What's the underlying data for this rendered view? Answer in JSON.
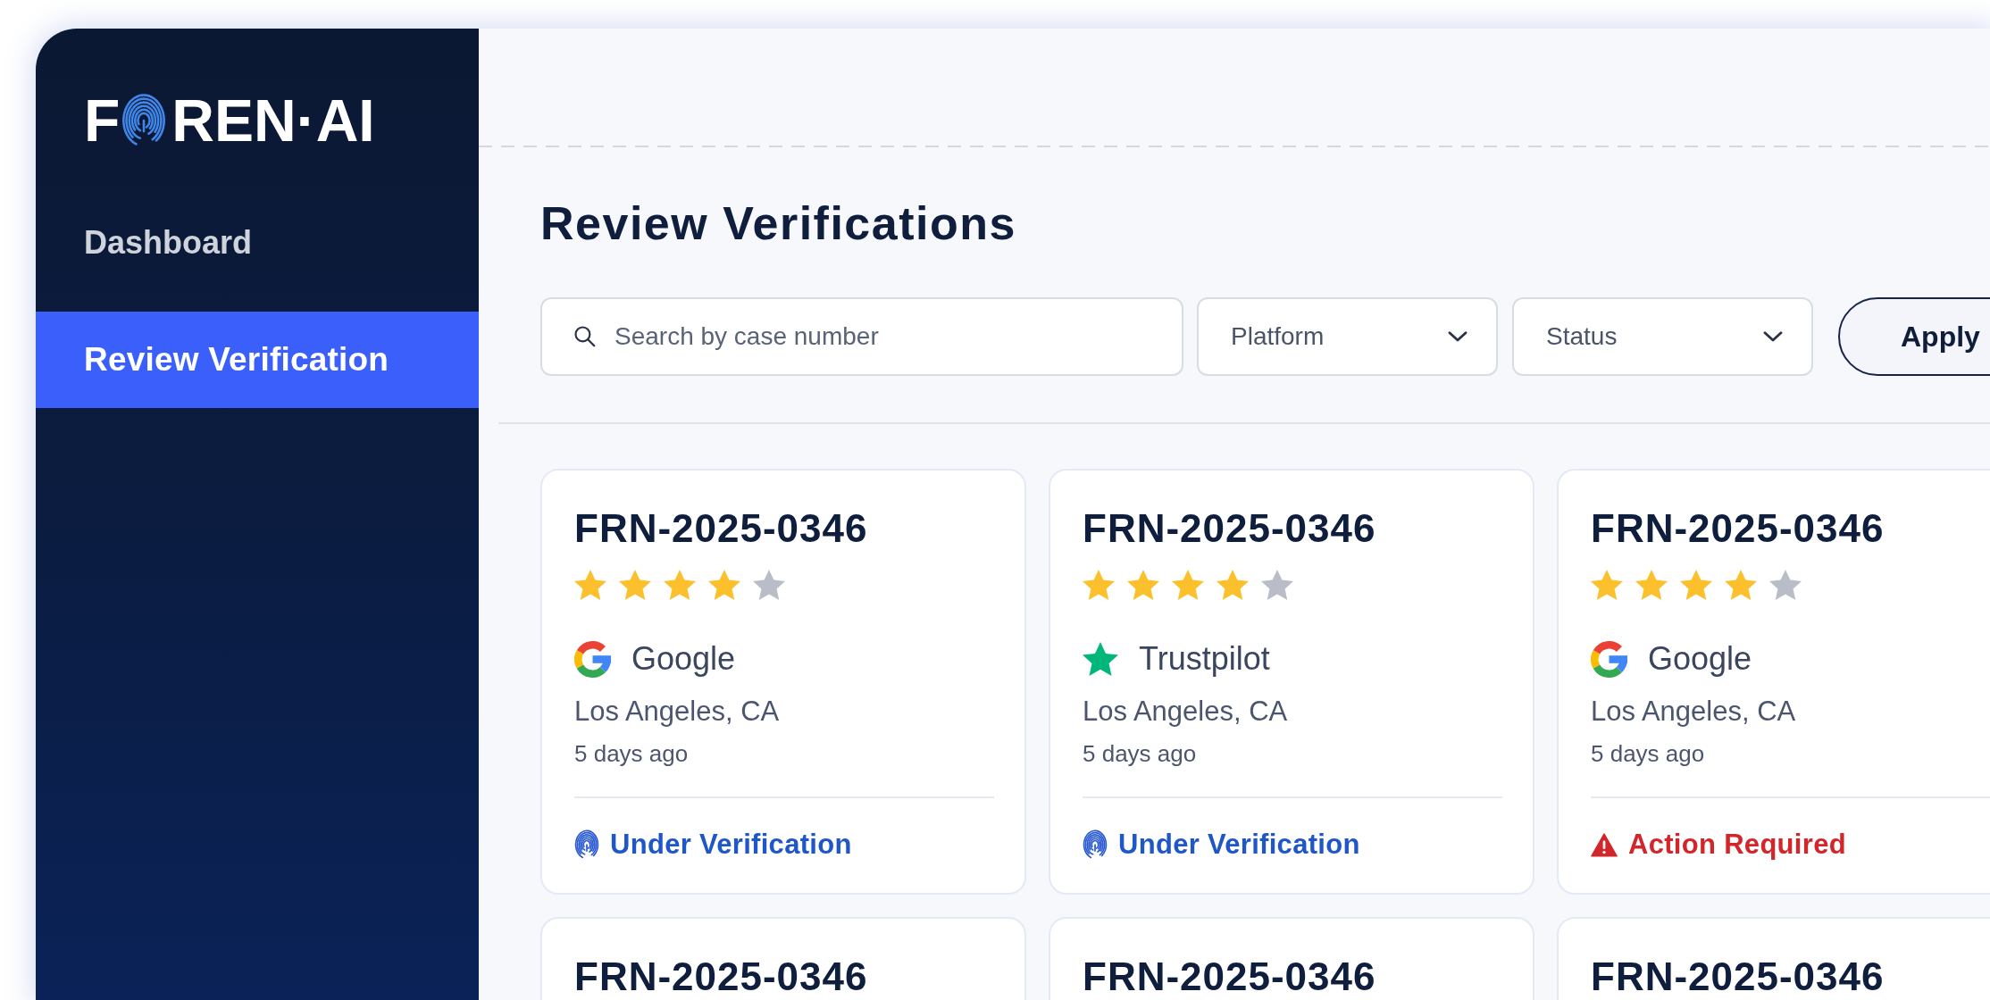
{
  "sidebar": {
    "logo": {
      "text_before_icon": "F",
      "text_after_icon": "REN·AI"
    },
    "items": [
      {
        "label": "Dashboard",
        "selected": false
      },
      {
        "label": "Review Verification",
        "selected": true
      }
    ]
  },
  "page": {
    "title": "Review Verifications"
  },
  "filters": {
    "search": {
      "placeholder": "Search by case number"
    },
    "dropdowns": [
      {
        "label": "Platform"
      },
      {
        "label": "Status"
      }
    ],
    "apply_button": {
      "label": "Apply"
    }
  },
  "cards": [
    {
      "case": "FRN-2025-0346",
      "stars": 4,
      "platform": {
        "kind": "google",
        "name": "Google"
      },
      "location": "Los Angeles, CA",
      "time": "5 days ago",
      "status": {
        "kind": "verification",
        "label": "Under Verification"
      }
    },
    {
      "case": "FRN-2025-0346",
      "stars": 4,
      "platform": {
        "kind": "trustpilot",
        "name": "Trustpilot"
      },
      "location": "Los Angeles, CA",
      "time": "5 days ago",
      "status": {
        "kind": "verification",
        "label": "Under Verification"
      }
    },
    {
      "case": "FRN-2025-0346",
      "stars": 4,
      "platform": {
        "kind": "google",
        "name": "Google"
      },
      "location": "Los Angeles, CA",
      "time": "5 days ago",
      "status": {
        "kind": "alert",
        "label": "Action Required"
      }
    },
    {
      "case": "FRN-2025-0346"
    },
    {
      "case": "FRN-2025-0346"
    },
    {
      "case": "FRN-2025-0346"
    }
  ]
}
